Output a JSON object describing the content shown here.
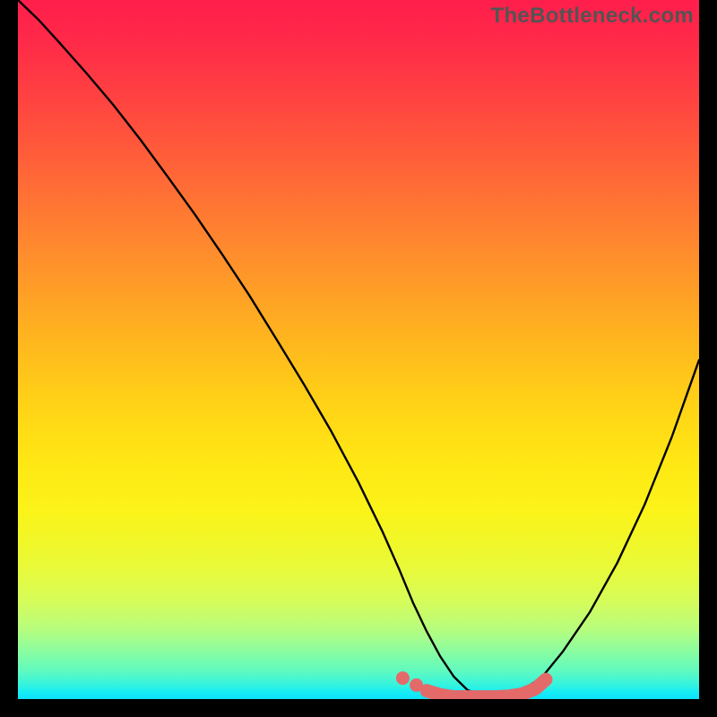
{
  "watermark": "TheBottleneck.com",
  "colors": {
    "background": "#000000",
    "curve": "#000000",
    "highlight": "#e46a6a",
    "gradient_top": "#ff1e4c",
    "gradient_mid": "#ffe714",
    "gradient_bottom": "#0ee2fe"
  },
  "chart_data": {
    "type": "line",
    "title": "",
    "xlabel": "",
    "ylabel": "",
    "xlim": [
      0,
      100
    ],
    "ylim": [
      0,
      100
    ],
    "grid": false,
    "legend": false,
    "series": [
      {
        "name": "bottleneck-curve",
        "x": [
          0,
          3,
          6,
          10,
          14,
          18,
          22,
          26,
          30,
          34,
          38,
          42,
          46,
          50,
          53.5,
          56,
          58,
          60,
          62,
          64,
          66,
          68,
          70,
          72,
          74,
          77,
          80,
          84,
          88,
          92,
          96,
          100
        ],
        "y": [
          100,
          97.2,
          94.0,
          89.6,
          85.0,
          80.0,
          74.7,
          69.3,
          63.6,
          57.7,
          51.4,
          45.0,
          38.3,
          31.0,
          24.0,
          18.5,
          13.8,
          9.7,
          6.1,
          3.2,
          1.3,
          0.5,
          0.3,
          0.5,
          1.2,
          3.2,
          6.8,
          12.5,
          19.5,
          27.8,
          37.5,
          48.5
        ]
      },
      {
        "name": "optimal-range-highlight",
        "x": [
          56.5,
          58.5,
          60.0,
          62.0,
          64.0,
          66.0,
          68.0,
          70.0,
          72.0,
          74.0,
          76.0,
          77.5
        ],
        "y": [
          3.0,
          2.0,
          1.2,
          0.6,
          0.3,
          0.3,
          0.3,
          0.3,
          0.4,
          0.7,
          1.5,
          2.8
        ]
      }
    ],
    "annotations": []
  }
}
